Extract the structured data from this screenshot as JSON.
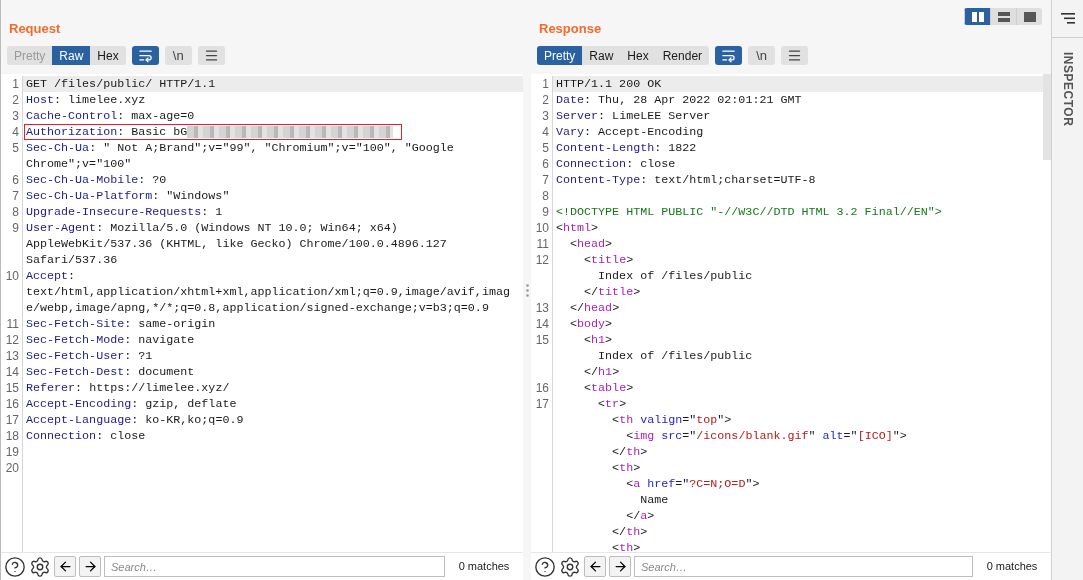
{
  "layout_buttons": [
    {
      "kind": "columns",
      "selected": true
    },
    {
      "kind": "rows",
      "selected": false
    },
    {
      "kind": "single",
      "selected": false
    }
  ],
  "panels": [
    {
      "title": "Request",
      "tabs": [
        {
          "label": "Pretty",
          "selected": false,
          "disabled": true
        },
        {
          "label": "Raw",
          "selected": true,
          "disabled": false
        },
        {
          "label": "Hex",
          "selected": false,
          "disabled": false
        }
      ],
      "tools": [
        {
          "kind": "wrap",
          "on": true
        },
        {
          "kind": "text",
          "label": "\\n",
          "on": false
        },
        {
          "kind": "menu",
          "on": false
        }
      ],
      "lines": [
        {
          "number": "1",
          "current": true,
          "highlighted": false,
          "rows": [
            {
              "parts": [
                {
                  "kind": "plain",
                  "text": "GET /files/public/ HTTP/1.1"
                }
              ]
            }
          ]
        },
        {
          "number": "2",
          "current": false,
          "highlighted": false,
          "rows": [
            {
              "parts": [
                {
                  "kind": "key",
                  "text": "Host"
                },
                {
                  "kind": "plain",
                  "text": ": limelee.xyz"
                }
              ]
            }
          ]
        },
        {
          "number": "3",
          "current": false,
          "highlighted": false,
          "rows": [
            {
              "parts": [
                {
                  "kind": "key",
                  "text": "Cache-Control"
                },
                {
                  "kind": "plain",
                  "text": ": max-age=0"
                }
              ]
            }
          ]
        },
        {
          "number": "4",
          "current": false,
          "highlighted": true,
          "rows": [
            {
              "parts": [
                {
                  "kind": "key",
                  "text": "Authorization"
                },
                {
                  "kind": "plain",
                  "text": ": Basic bG"
                },
                {
                  "kind": "redacted"
                }
              ]
            }
          ]
        },
        {
          "number": "5",
          "current": false,
          "highlighted": false,
          "rows": [
            {
              "parts": [
                {
                  "kind": "key",
                  "text": "Sec-Ch-Ua"
                },
                {
                  "kind": "plain",
                  "text": ": \" Not A;Brand\";v=\"99\", \"Chromium\";v=\"100\", \"Google"
                }
              ]
            },
            {
              "parts": [
                {
                  "kind": "plain",
                  "text": "Chrome\";v=\"100\""
                }
              ]
            }
          ]
        },
        {
          "number": "6",
          "current": false,
          "highlighted": false,
          "rows": [
            {
              "parts": [
                {
                  "kind": "key",
                  "text": "Sec-Ch-Ua-Mobile"
                },
                {
                  "kind": "plain",
                  "text": ": ?0"
                }
              ]
            }
          ]
        },
        {
          "number": "7",
          "current": false,
          "highlighted": false,
          "rows": [
            {
              "parts": [
                {
                  "kind": "key",
                  "text": "Sec-Ch-Ua-Platform"
                },
                {
                  "kind": "plain",
                  "text": ": \"Windows\""
                }
              ]
            }
          ]
        },
        {
          "number": "8",
          "current": false,
          "highlighted": false,
          "rows": [
            {
              "parts": [
                {
                  "kind": "key",
                  "text": "Upgrade-Insecure-Requests"
                },
                {
                  "kind": "plain",
                  "text": ": 1"
                }
              ]
            }
          ]
        },
        {
          "number": "9",
          "current": false,
          "highlighted": false,
          "rows": [
            {
              "parts": [
                {
                  "kind": "key",
                  "text": "User-Agent"
                },
                {
                  "kind": "plain",
                  "text": ": Mozilla/5.0 (Windows NT 10.0; Win64; x64)"
                }
              ]
            },
            {
              "parts": [
                {
                  "kind": "plain",
                  "text": "AppleWebKit/537.36 (KHTML, like Gecko) Chrome/100.0.4896.127"
                }
              ]
            },
            {
              "parts": [
                {
                  "kind": "plain",
                  "text": "Safari/537.36"
                }
              ]
            }
          ]
        },
        {
          "number": "10",
          "current": false,
          "highlighted": false,
          "rows": [
            {
              "parts": [
                {
                  "kind": "key",
                  "text": "Accept"
                },
                {
                  "kind": "plain",
                  "text": ":"
                }
              ]
            },
            {
              "parts": [
                {
                  "kind": "plain",
                  "text": "text/html,application/xhtml+xml,application/xml;q=0.9,image/avif,imag"
                }
              ]
            },
            {
              "parts": [
                {
                  "kind": "plain",
                  "text": "e/webp,image/apng,*/*;q=0.8,application/signed-exchange;v=b3;q=0.9"
                }
              ]
            }
          ]
        },
        {
          "number": "11",
          "current": false,
          "highlighted": false,
          "rows": [
            {
              "parts": [
                {
                  "kind": "key",
                  "text": "Sec-Fetch-Site"
                },
                {
                  "kind": "plain",
                  "text": ": same-origin"
                }
              ]
            }
          ]
        },
        {
          "number": "12",
          "current": false,
          "highlighted": false,
          "rows": [
            {
              "parts": [
                {
                  "kind": "key",
                  "text": "Sec-Fetch-Mode"
                },
                {
                  "kind": "plain",
                  "text": ": navigate"
                }
              ]
            }
          ]
        },
        {
          "number": "13",
          "current": false,
          "highlighted": false,
          "rows": [
            {
              "parts": [
                {
                  "kind": "key",
                  "text": "Sec-Fetch-User"
                },
                {
                  "kind": "plain",
                  "text": ": ?1"
                }
              ]
            }
          ]
        },
        {
          "number": "14",
          "current": false,
          "highlighted": false,
          "rows": [
            {
              "parts": [
                {
                  "kind": "key",
                  "text": "Sec-Fetch-Dest"
                },
                {
                  "kind": "plain",
                  "text": ": document"
                }
              ]
            }
          ]
        },
        {
          "number": "15",
          "current": false,
          "highlighted": false,
          "rows": [
            {
              "parts": [
                {
                  "kind": "key",
                  "text": "Referer"
                },
                {
                  "kind": "plain",
                  "text": ": https://limelee.xyz/"
                }
              ]
            }
          ]
        },
        {
          "number": "16",
          "current": false,
          "highlighted": false,
          "rows": [
            {
              "parts": [
                {
                  "kind": "key",
                  "text": "Accept-Encoding"
                },
                {
                  "kind": "plain",
                  "text": ": gzip, deflate"
                }
              ]
            }
          ]
        },
        {
          "number": "17",
          "current": false,
          "highlighted": false,
          "rows": [
            {
              "parts": [
                {
                  "kind": "key",
                  "text": "Accept-Language"
                },
                {
                  "kind": "plain",
                  "text": ": ko-KR,ko;q=0.9"
                }
              ]
            }
          ]
        },
        {
          "number": "18",
          "current": false,
          "highlighted": false,
          "rows": [
            {
              "parts": [
                {
                  "kind": "key",
                  "text": "Connection"
                },
                {
                  "kind": "plain",
                  "text": ": close"
                }
              ]
            }
          ]
        },
        {
          "number": "19",
          "current": false,
          "highlighted": false,
          "rows": [
            {
              "parts": []
            }
          ]
        },
        {
          "number": "20",
          "current": false,
          "highlighted": false,
          "rows": [
            {
              "parts": []
            }
          ]
        }
      ],
      "search": {
        "placeholder": "Search…",
        "matches": "0 matches"
      }
    },
    {
      "title": "Response",
      "tabs": [
        {
          "label": "Pretty",
          "selected": true,
          "disabled": false
        },
        {
          "label": "Raw",
          "selected": false,
          "disabled": false
        },
        {
          "label": "Hex",
          "selected": false,
          "disabled": false
        },
        {
          "label": "Render",
          "selected": false,
          "disabled": false
        }
      ],
      "tools": [
        {
          "kind": "wrap",
          "on": true
        },
        {
          "kind": "text",
          "label": "\\n",
          "on": false
        },
        {
          "kind": "menu",
          "on": false
        }
      ],
      "lines": [
        {
          "number": "1",
          "current": true,
          "highlighted": false,
          "rows": [
            {
              "parts": [
                {
                  "kind": "plain",
                  "text": "HTTP/1.1 200 OK"
                }
              ]
            }
          ]
        },
        {
          "number": "2",
          "current": false,
          "highlighted": false,
          "rows": [
            {
              "parts": [
                {
                  "kind": "key",
                  "text": "Date"
                },
                {
                  "kind": "plain",
                  "text": ": Thu, 28 Apr 2022 02:01:21 GMT"
                }
              ]
            }
          ]
        },
        {
          "number": "3",
          "current": false,
          "highlighted": false,
          "rows": [
            {
              "parts": [
                {
                  "kind": "key",
                  "text": "Server"
                },
                {
                  "kind": "plain",
                  "text": ": LimeLEE Server"
                }
              ]
            }
          ]
        },
        {
          "number": "4",
          "current": false,
          "highlighted": false,
          "rows": [
            {
              "parts": [
                {
                  "kind": "key",
                  "text": "Vary"
                },
                {
                  "kind": "plain",
                  "text": ": Accept-Encoding"
                }
              ]
            }
          ]
        },
        {
          "number": "5",
          "current": false,
          "highlighted": false,
          "rows": [
            {
              "parts": [
                {
                  "kind": "key",
                  "text": "Content-Length"
                },
                {
                  "kind": "plain",
                  "text": ": 1822"
                }
              ]
            }
          ]
        },
        {
          "number": "6",
          "current": false,
          "highlighted": false,
          "rows": [
            {
              "parts": [
                {
                  "kind": "key",
                  "text": "Connection"
                },
                {
                  "kind": "plain",
                  "text": ": close"
                }
              ]
            }
          ]
        },
        {
          "number": "7",
          "current": false,
          "highlighted": false,
          "rows": [
            {
              "parts": [
                {
                  "kind": "key",
                  "text": "Content-Type"
                },
                {
                  "kind": "plain",
                  "text": ": text/html;charset=UTF-8"
                }
              ]
            }
          ]
        },
        {
          "number": "8",
          "current": false,
          "highlighted": false,
          "rows": [
            {
              "parts": []
            }
          ]
        },
        {
          "number": "9",
          "current": false,
          "highlighted": false,
          "rows": [
            {
              "parts": [
                {
                  "kind": "doctype",
                  "text": "<!DOCTYPE HTML PUBLIC \"-//W3C//DTD HTML 3.2 Final//EN\">"
                }
              ]
            }
          ]
        },
        {
          "number": "10",
          "current": false,
          "highlighted": false,
          "rows": [
            {
              "parts": [
                {
                  "kind": "plain",
                  "text": "<"
                },
                {
                  "kind": "tag",
                  "text": "html"
                },
                {
                  "kind": "plain",
                  "text": ">"
                }
              ]
            }
          ]
        },
        {
          "number": "11",
          "current": false,
          "highlighted": false,
          "rows": [
            {
              "parts": [
                {
                  "kind": "plain",
                  "text": "  <"
                },
                {
                  "kind": "tag",
                  "text": "head"
                },
                {
                  "kind": "plain",
                  "text": ">"
                }
              ]
            }
          ]
        },
        {
          "number": "12",
          "current": false,
          "highlighted": false,
          "rows": [
            {
              "parts": [
                {
                  "kind": "plain",
                  "text": "    <"
                },
                {
                  "kind": "tag",
                  "text": "title"
                },
                {
                  "kind": "plain",
                  "text": ">"
                }
              ]
            },
            {
              "parts": [
                {
                  "kind": "plain",
                  "text": "      Index of /files/public"
                }
              ]
            },
            {
              "parts": [
                {
                  "kind": "plain",
                  "text": "    </"
                },
                {
                  "kind": "tag",
                  "text": "title"
                },
                {
                  "kind": "plain",
                  "text": ">"
                }
              ]
            }
          ]
        },
        {
          "number": "13",
          "current": false,
          "highlighted": false,
          "rows": [
            {
              "parts": [
                {
                  "kind": "plain",
                  "text": "  </"
                },
                {
                  "kind": "tag",
                  "text": "head"
                },
                {
                  "kind": "plain",
                  "text": ">"
                }
              ]
            }
          ]
        },
        {
          "number": "14",
          "current": false,
          "highlighted": false,
          "rows": [
            {
              "parts": [
                {
                  "kind": "plain",
                  "text": "  <"
                },
                {
                  "kind": "tag",
                  "text": "body"
                },
                {
                  "kind": "plain",
                  "text": ">"
                }
              ]
            }
          ]
        },
        {
          "number": "15",
          "current": false,
          "highlighted": false,
          "rows": [
            {
              "parts": [
                {
                  "kind": "plain",
                  "text": "    <"
                },
                {
                  "kind": "tag",
                  "text": "h1"
                },
                {
                  "kind": "plain",
                  "text": ">"
                }
              ]
            },
            {
              "parts": [
                {
                  "kind": "plain",
                  "text": "      Index of /files/public"
                }
              ]
            },
            {
              "parts": [
                {
                  "kind": "plain",
                  "text": "    </"
                },
                {
                  "kind": "tag",
                  "text": "h1"
                },
                {
                  "kind": "plain",
                  "text": ">"
                }
              ]
            }
          ]
        },
        {
          "number": "16",
          "current": false,
          "highlighted": false,
          "rows": [
            {
              "parts": [
                {
                  "kind": "plain",
                  "text": "    <"
                },
                {
                  "kind": "tag",
                  "text": "table"
                },
                {
                  "kind": "plain",
                  "text": ">"
                }
              ]
            }
          ]
        },
        {
          "number": "17",
          "current": false,
          "highlighted": false,
          "rows": [
            {
              "parts": [
                {
                  "kind": "plain",
                  "text": "      <"
                },
                {
                  "kind": "tag",
                  "text": "tr"
                },
                {
                  "kind": "plain",
                  "text": ">"
                }
              ]
            },
            {
              "parts": [
                {
                  "kind": "plain",
                  "text": "        <"
                },
                {
                  "kind": "tag",
                  "text": "th"
                },
                {
                  "kind": "attr",
                  "text": " valign"
                },
                {
                  "kind": "plain",
                  "text": "=\""
                },
                {
                  "kind": "string",
                  "text": "top"
                },
                {
                  "kind": "plain",
                  "text": "\">"
                }
              ]
            },
            {
              "parts": [
                {
                  "kind": "plain",
                  "text": "          <"
                },
                {
                  "kind": "tag",
                  "text": "img"
                },
                {
                  "kind": "attr",
                  "text": " src"
                },
                {
                  "kind": "plain",
                  "text": "=\""
                },
                {
                  "kind": "string",
                  "text": "/icons/blank.gif"
                },
                {
                  "kind": "plain",
                  "text": "\" "
                },
                {
                  "kind": "attr",
                  "text": "alt"
                },
                {
                  "kind": "plain",
                  "text": "=\""
                },
                {
                  "kind": "string",
                  "text": "[ICO]"
                },
                {
                  "kind": "plain",
                  "text": "\">"
                }
              ]
            },
            {
              "parts": [
                {
                  "kind": "plain",
                  "text": "        </"
                },
                {
                  "kind": "tag",
                  "text": "th"
                },
                {
                  "kind": "plain",
                  "text": ">"
                }
              ]
            },
            {
              "parts": [
                {
                  "kind": "plain",
                  "text": "        <"
                },
                {
                  "kind": "tag",
                  "text": "th"
                },
                {
                  "kind": "plain",
                  "text": ">"
                }
              ]
            },
            {
              "parts": [
                {
                  "kind": "plain",
                  "text": "          <"
                },
                {
                  "kind": "tag",
                  "text": "a"
                },
                {
                  "kind": "attr",
                  "text": " href"
                },
                {
                  "kind": "plain",
                  "text": "=\""
                },
                {
                  "kind": "string",
                  "text": "?C=N;O=D"
                },
                {
                  "kind": "plain",
                  "text": "\">"
                }
              ]
            },
            {
              "parts": [
                {
                  "kind": "plain",
                  "text": "            Name"
                }
              ]
            },
            {
              "parts": [
                {
                  "kind": "plain",
                  "text": "          </"
                },
                {
                  "kind": "tag",
                  "text": "a"
                },
                {
                  "kind": "plain",
                  "text": ">"
                }
              ]
            },
            {
              "parts": [
                {
                  "kind": "plain",
                  "text": "        </"
                },
                {
                  "kind": "tag",
                  "text": "th"
                },
                {
                  "kind": "plain",
                  "text": ">"
                }
              ]
            },
            {
              "parts": [
                {
                  "kind": "plain",
                  "text": "        <"
                },
                {
                  "kind": "tag",
                  "text": "th"
                },
                {
                  "kind": "plain",
                  "text": ">"
                }
              ]
            }
          ]
        }
      ],
      "search": {
        "placeholder": "Search…",
        "matches": "0 matches"
      }
    }
  ],
  "sidebar": {
    "title": "INSPECTOR"
  }
}
